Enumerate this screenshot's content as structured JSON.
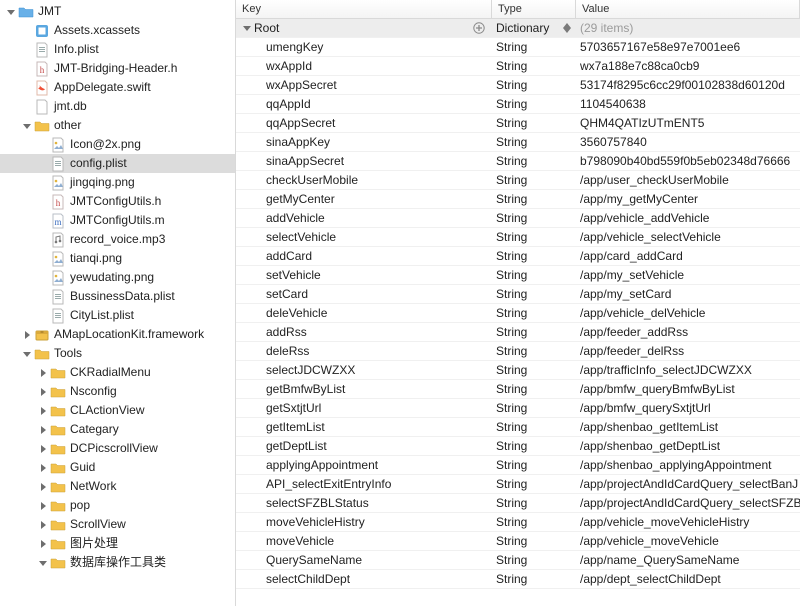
{
  "sidebar": {
    "items": [
      {
        "label": "JMT",
        "indent": 0,
        "icon": "folder-blue",
        "expandable": true,
        "expanded": true
      },
      {
        "label": "Assets.xcassets",
        "indent": 1,
        "icon": "assets",
        "expandable": false
      },
      {
        "label": "Info.plist",
        "indent": 1,
        "icon": "plist",
        "expandable": false
      },
      {
        "label": "JMT-Bridging-Header.h",
        "indent": 1,
        "icon": "h",
        "expandable": false
      },
      {
        "label": "AppDelegate.swift",
        "indent": 1,
        "icon": "swift",
        "expandable": false
      },
      {
        "label": "jmt.db",
        "indent": 1,
        "icon": "generic",
        "expandable": false
      },
      {
        "label": "other",
        "indent": 1,
        "icon": "folder",
        "expandable": true,
        "expanded": true
      },
      {
        "label": "Icon@2x.png",
        "indent": 2,
        "icon": "png",
        "expandable": false
      },
      {
        "label": "config.plist",
        "indent": 2,
        "icon": "plist",
        "expandable": false,
        "selected": true
      },
      {
        "label": "jingqing.png",
        "indent": 2,
        "icon": "png",
        "expandable": false
      },
      {
        "label": "JMTConfigUtils.h",
        "indent": 2,
        "icon": "h",
        "expandable": false
      },
      {
        "label": "JMTConfigUtils.m",
        "indent": 2,
        "icon": "m",
        "expandable": false
      },
      {
        "label": "record_voice.mp3",
        "indent": 2,
        "icon": "audio",
        "expandable": false
      },
      {
        "label": "tianqi.png",
        "indent": 2,
        "icon": "png",
        "expandable": false
      },
      {
        "label": "yewudating.png",
        "indent": 2,
        "icon": "png",
        "expandable": false
      },
      {
        "label": "BussinessData.plist",
        "indent": 2,
        "icon": "plist",
        "expandable": false
      },
      {
        "label": "CityList.plist",
        "indent": 2,
        "icon": "plist",
        "expandable": false
      },
      {
        "label": "AMapLocationKit.framework",
        "indent": 1,
        "icon": "framework",
        "expandable": true,
        "expanded": false
      },
      {
        "label": "Tools",
        "indent": 1,
        "icon": "folder",
        "expandable": true,
        "expanded": true
      },
      {
        "label": "CKRadialMenu",
        "indent": 2,
        "icon": "folder",
        "expandable": true,
        "expanded": false
      },
      {
        "label": "Nsconfig",
        "indent": 2,
        "icon": "folder",
        "expandable": true,
        "expanded": false
      },
      {
        "label": "CLActionView",
        "indent": 2,
        "icon": "folder",
        "expandable": true,
        "expanded": false
      },
      {
        "label": "Categary",
        "indent": 2,
        "icon": "folder",
        "expandable": true,
        "expanded": false
      },
      {
        "label": "DCPicscrollView",
        "indent": 2,
        "icon": "folder",
        "expandable": true,
        "expanded": false
      },
      {
        "label": "Guid",
        "indent": 2,
        "icon": "folder",
        "expandable": true,
        "expanded": false
      },
      {
        "label": "NetWork",
        "indent": 2,
        "icon": "folder",
        "expandable": true,
        "expanded": false
      },
      {
        "label": "pop",
        "indent": 2,
        "icon": "folder",
        "expandable": true,
        "expanded": false
      },
      {
        "label": "ScrollView",
        "indent": 2,
        "icon": "folder",
        "expandable": true,
        "expanded": false
      },
      {
        "label": "图片处理",
        "indent": 2,
        "icon": "folder",
        "expandable": true,
        "expanded": false
      },
      {
        "label": "数据库操作工具类",
        "indent": 2,
        "icon": "folder",
        "expandable": true,
        "expanded": true
      }
    ]
  },
  "plist": {
    "headers": {
      "key": "Key",
      "type": "Type",
      "value": "Value"
    },
    "root": {
      "key": "Root",
      "type": "Dictionary",
      "value": "(29 items)"
    },
    "rows": [
      {
        "key": "umengKey",
        "type": "String",
        "value": "5703657167e58e97e7001ee6"
      },
      {
        "key": "wxAppId",
        "type": "String",
        "value": "wx7a188e7c88ca0cb9"
      },
      {
        "key": "wxAppSecret",
        "type": "String",
        "value": "53174f8295c6cc29f00102838d60120d"
      },
      {
        "key": "qqAppId",
        "type": "String",
        "value": "1104540638"
      },
      {
        "key": "qqAppSecret",
        "type": "String",
        "value": "QHM4QATIzUTmENT5"
      },
      {
        "key": "sinaAppKey",
        "type": "String",
        "value": "3560757840"
      },
      {
        "key": "sinaAppSecret",
        "type": "String",
        "value": "b798090b40bd559f0b5eb02348d76666"
      },
      {
        "key": "checkUserMobile",
        "type": "String",
        "value": "/app/user_checkUserMobile"
      },
      {
        "key": "getMyCenter",
        "type": "String",
        "value": "/app/my_getMyCenter"
      },
      {
        "key": "addVehicle",
        "type": "String",
        "value": "/app/vehicle_addVehicle"
      },
      {
        "key": "selectVehicle",
        "type": "String",
        "value": "/app/vehicle_selectVehicle"
      },
      {
        "key": "addCard",
        "type": "String",
        "value": "/app/card_addCard"
      },
      {
        "key": "setVehicle",
        "type": "String",
        "value": "/app/my_setVehicle"
      },
      {
        "key": "setCard",
        "type": "String",
        "value": "/app/my_setCard"
      },
      {
        "key": "deleVehicle",
        "type": "String",
        "value": "/app/vehicle_delVehicle"
      },
      {
        "key": "addRss",
        "type": "String",
        "value": "/app/feeder_addRss"
      },
      {
        "key": "deleRss",
        "type": "String",
        "value": "/app/feeder_delRss"
      },
      {
        "key": "selectJDCWZXX",
        "type": "String",
        "value": "/app/trafficInfo_selectJDCWZXX"
      },
      {
        "key": "getBmfwByList",
        "type": "String",
        "value": "/app/bmfw_queryBmfwByList"
      },
      {
        "key": "getSxtjtUrl",
        "type": "String",
        "value": "/app/bmfw_querySxtjtUrl"
      },
      {
        "key": "getItemList",
        "type": "String",
        "value": "/app/shenbao_getItemList"
      },
      {
        "key": "getDeptList",
        "type": "String",
        "value": "/app/shenbao_getDeptList"
      },
      {
        "key": "applyingAppointment",
        "type": "String",
        "value": "/app/shenbao_applyingAppointment"
      },
      {
        "key": "API_selectExitEntryInfo",
        "type": "String",
        "value": "/app/projectAndIdCardQuery_selectBanJ"
      },
      {
        "key": "selectSFZBLStatus",
        "type": "String",
        "value": "/app/projectAndIdCardQuery_selectSFZB"
      },
      {
        "key": "moveVehicleHistry",
        "type": "String",
        "value": "/app/vehicle_moveVehicleHistry"
      },
      {
        "key": "moveVehicle",
        "type": "String",
        "value": "/app/vehicle_moveVehicle"
      },
      {
        "key": "QuerySameName",
        "type": "String",
        "value": "/app/name_QuerySameName"
      },
      {
        "key": "selectChildDept",
        "type": "String",
        "value": "/app/dept_selectChildDept"
      }
    ]
  }
}
